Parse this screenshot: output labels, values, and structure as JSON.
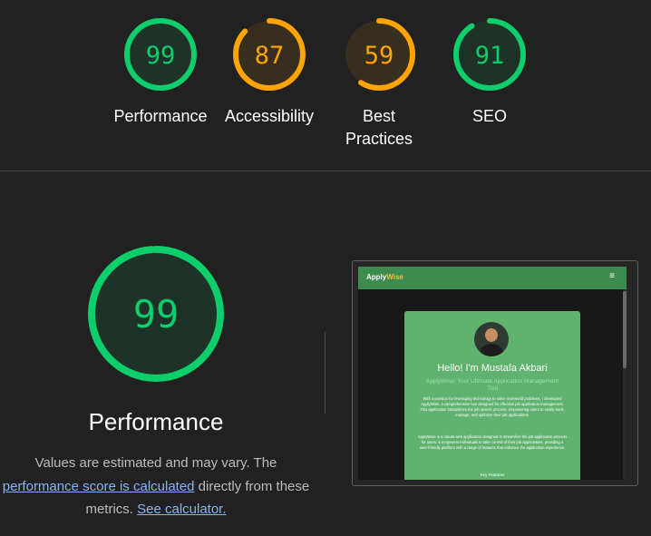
{
  "summary": {
    "gauges": [
      {
        "score": "99",
        "label": "Performance",
        "value": 0.99,
        "color": "#0cce6b"
      },
      {
        "score": "87",
        "label": "Accessibility",
        "value": 0.87,
        "color": "#ffa400"
      },
      {
        "score": "59",
        "label": "Best Practices",
        "value": 0.59,
        "color": "#ffa400"
      },
      {
        "score": "91",
        "label": "SEO",
        "value": 0.91,
        "color": "#0cce6b"
      }
    ]
  },
  "detail": {
    "score": "99",
    "value": 0.99,
    "color": "#0cce6b",
    "title": "Performance",
    "desc_prefix": "Values are estimated and may vary. The",
    "score_link": "performance score is calculated",
    "desc_middle": " directly from these metrics. ",
    "calc_link": "See calculator."
  },
  "screenshot": {
    "brand_main": "Apply",
    "brand_accent": "Wise",
    "menu_glyph": "≡",
    "heading": "Hello! I'm Mustafa Akbari",
    "subheading": "ApplyWise: Your Ultimate Application Management Tool",
    "paragraph1": "With a passion for leveraging technology to solve real-world problems, I developed ApplyWise, a comprehensive tool designed for effective job application management. This application streamlines the job search process, empowering users to easily track, manage, and optimize their job applications.",
    "paragraph2": "ApplyWise is a robust web application designed to streamline the job application process for users. It empowers individuals to take control of their job applications, providing a user-friendly platform with a range of features that enhance the application experience.",
    "footer": "Key Features"
  },
  "colors": {
    "background": "#212121",
    "pass": "#0cce6b",
    "average": "#ffa400",
    "link": "#8ab4f8"
  }
}
